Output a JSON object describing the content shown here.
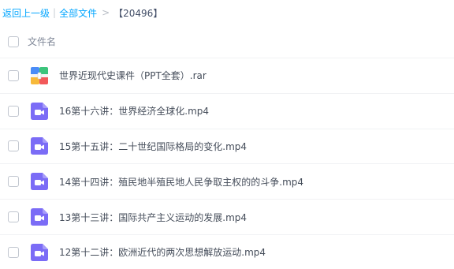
{
  "breadcrumb": {
    "back_label": "返回上一级",
    "separator": "|",
    "all_files_label": "全部文件",
    "arrow": ">",
    "count_text": "【20496】"
  },
  "header": {
    "column_name_label": "文件名"
  },
  "files": [
    {
      "name": "世界近现代史课件（PPT全套）.rar",
      "icon": "rar-archive-icon"
    },
    {
      "name": "16第十六讲：世界经济全球化.mp4",
      "icon": "video-icon"
    },
    {
      "name": "15第十五讲：二十世纪国际格局的变化.mp4",
      "icon": "video-icon"
    },
    {
      "name": "14第十四讲：殖民地半殖民地人民争取主权的的斗争.mp4",
      "icon": "video-icon"
    },
    {
      "name": "13第十三讲：国际共产主义运动的发展.mp4",
      "icon": "video-icon"
    },
    {
      "name": "12第十二讲：欧洲近代的两次思想解放运动.mp4",
      "icon": "video-icon"
    }
  ],
  "colors": {
    "link": "#06a7ff",
    "video_icon": "#7b6cf6",
    "archive_blue": "#4a8cf7",
    "archive_green": "#3cc47c",
    "archive_yellow": "#f7b93a",
    "archive_red": "#f2595a"
  }
}
